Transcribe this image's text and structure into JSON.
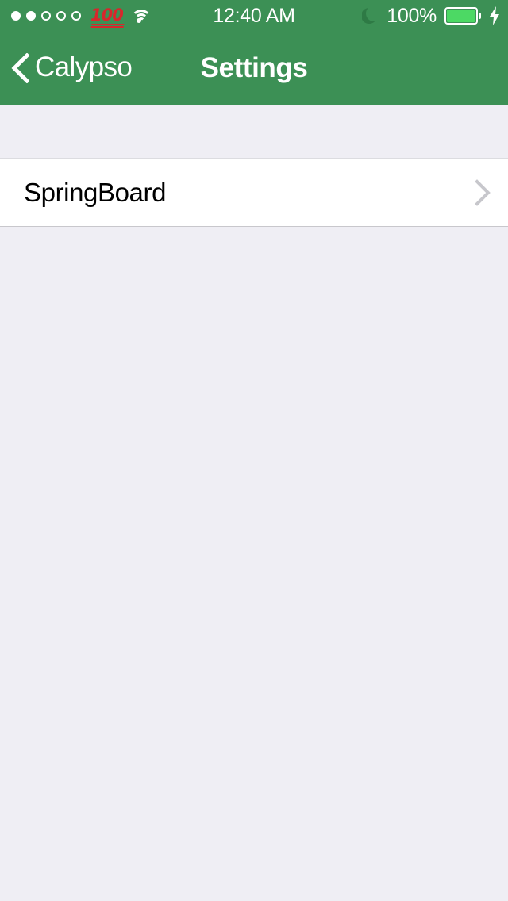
{
  "status_bar": {
    "page_dots": {
      "total": 5,
      "filled": 2
    },
    "emoji_100": "100",
    "wifi_icon": "wifi-icon",
    "time": "12:40 AM",
    "do_not_disturb_icon": "moon-icon",
    "battery_percent": "100%",
    "battery_level": 100,
    "charging": true,
    "charging_icon": "lightning-bolt-icon"
  },
  "nav_bar": {
    "back_label": "Calypso",
    "back_icon": "chevron-left-icon",
    "title": "Settings"
  },
  "content": {
    "sections": [
      {
        "rows": [
          {
            "label": "SpringBoard",
            "accessory_icon": "chevron-right-icon"
          }
        ]
      }
    ]
  },
  "colors": {
    "nav_bar_green": "#3C9055",
    "background_gray": "#EFEEF4",
    "row_white": "#FFFFFF",
    "separator": "#C8C7CC",
    "chevron_gray": "#C7C7CC",
    "battery_fill_green": "#4CD964",
    "emoji_red": "#D8262C",
    "label_black": "#000000"
  }
}
